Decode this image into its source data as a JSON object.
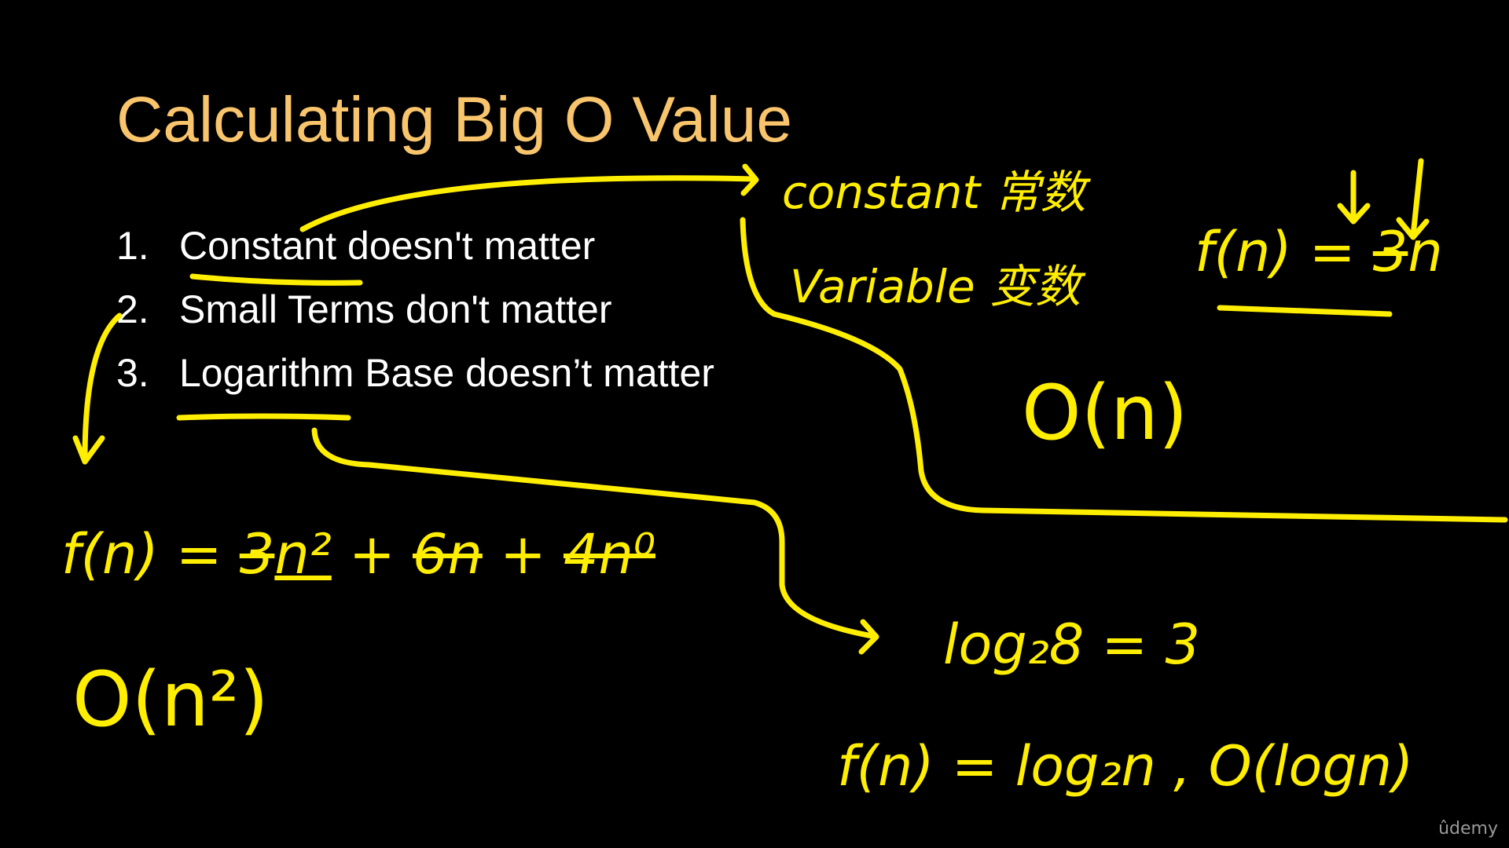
{
  "slide": {
    "title": "Calculating Big O Value",
    "rules": [
      {
        "num": "1.",
        "text": "Constant doesn't matter"
      },
      {
        "num": "2.",
        "text": "Small Terms don't matter"
      },
      {
        "num": "3.",
        "text": "Logarithm Base doesn’t matter"
      }
    ]
  },
  "annotations": {
    "constant_word": "constant",
    "constant_chinese": "常数",
    "variable_word": "Variable",
    "variable_chinese": "变数",
    "fn_3n": {
      "lhs": "f(n) = ",
      "coef": "3",
      "rest": "n"
    },
    "o_n": "O(n)",
    "poly": {
      "lhs": "f(n) = ",
      "coef": "3",
      "main": "n²",
      "plus1": " + ",
      "small1": "6n",
      "plus2": " + ",
      "small2": "4n⁰"
    },
    "o_n2": "O(n²)",
    "log_example": "log₂8 = 3",
    "fn_log": "f(n) = log₂n ,  O(logn)"
  },
  "brand": "ûdemy",
  "colors": {
    "background": "#000000",
    "title": "#f9c56c",
    "ink": "#ffee00",
    "text": "#ffffff"
  }
}
